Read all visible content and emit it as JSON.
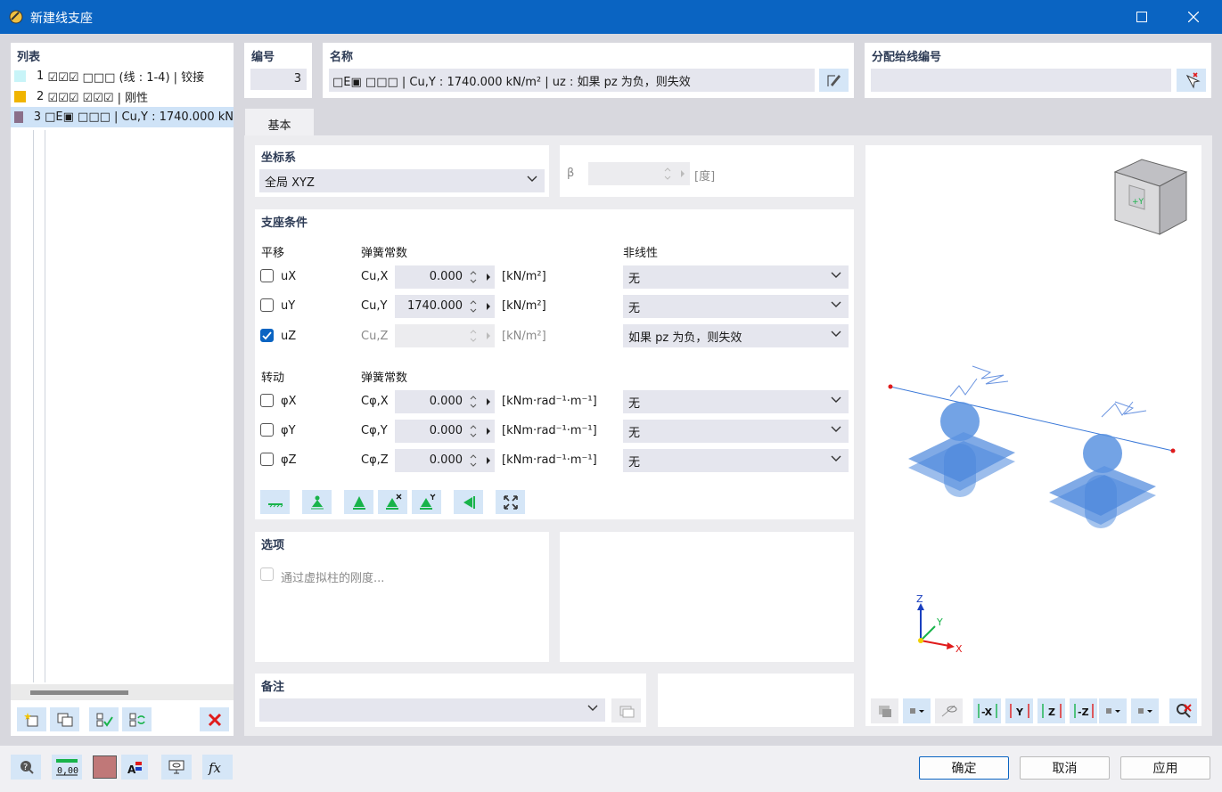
{
  "window": {
    "title": "新建线支座"
  },
  "list": {
    "header": "列表",
    "items": [
      {
        "num": "1",
        "text": "☑☑☑ □□□ (线 : 1-4) | 铰接",
        "color": "#c8f4f8"
      },
      {
        "num": "2",
        "text": "☑☑☑ ☑☑☑ | 刚性",
        "color": "#f0b400"
      },
      {
        "num": "3",
        "text": "□E▣ □□□ | Cu,Y : 1740.000 kN",
        "color": "#8a6f8a"
      }
    ]
  },
  "number": {
    "label": "编号",
    "value": "3"
  },
  "name": {
    "label": "名称",
    "value": "□E▣ □□□ | Cu,Y : 1740.000 kN/m² | uz : 如果 pz 为负，则失效"
  },
  "assign": {
    "label": "分配给线编号",
    "value": ""
  },
  "tab": {
    "label": "基本"
  },
  "coord": {
    "label": "坐标系",
    "value": "全局 XYZ"
  },
  "beta": {
    "symbol": "β",
    "value": "",
    "unit": "[度]"
  },
  "support": {
    "header": "支座条件",
    "trans_label": "平移",
    "spring_label": "弹簧常数",
    "nonlin_label": "非线性",
    "rot_label": "转动",
    "rot_spring_label": "弹簧常数",
    "trans": [
      {
        "name": "uX",
        "checked": false,
        "sym": "Cu,X",
        "value": "0.000",
        "unit": "[kN/m²]",
        "nonlin": "无"
      },
      {
        "name": "uY",
        "checked": false,
        "sym": "Cu,Y",
        "value": "1740.000",
        "unit": "[kN/m²]",
        "nonlin": "无"
      },
      {
        "name": "uZ",
        "checked": true,
        "sym": "Cu,Z",
        "value": "",
        "unit": "[kN/m²]",
        "nonlin": "如果 pz 为负，则失效"
      }
    ],
    "rot": [
      {
        "name": "φX",
        "checked": false,
        "sym": "Cφ,X",
        "value": "0.000",
        "unit": "[kNm·rad⁻¹·m⁻¹]",
        "nonlin": "无"
      },
      {
        "name": "φY",
        "checked": false,
        "sym": "Cφ,Y",
        "value": "0.000",
        "unit": "[kNm·rad⁻¹·m⁻¹]",
        "nonlin": "无"
      },
      {
        "name": "φZ",
        "checked": false,
        "sym": "Cφ,Z",
        "value": "0.000",
        "unit": "[kNm·rad⁻¹·m⁻¹]",
        "nonlin": "无"
      }
    ]
  },
  "options": {
    "header": "选项",
    "stiffness_label": "通过虚拟柱的刚度..."
  },
  "remark": {
    "header": "备注",
    "value": ""
  },
  "view": {
    "axis_z": "Z",
    "axis_y": "Y",
    "axis_x": "X",
    "cube_label": "+Y"
  },
  "view_toolbar": {
    "minus_x": "-X",
    "y": "Y",
    "z": "Z",
    "minus_z": "-Z"
  },
  "footer": {
    "ok": "确定",
    "cancel": "取消",
    "apply": "应用",
    "value_icon_text": "0,00"
  },
  "colors": {
    "accent": "#0a64c2",
    "panel": "#ffffff",
    "bg": "#d8d8de",
    "field": "#e5e6ee",
    "green": "#18b34a"
  }
}
